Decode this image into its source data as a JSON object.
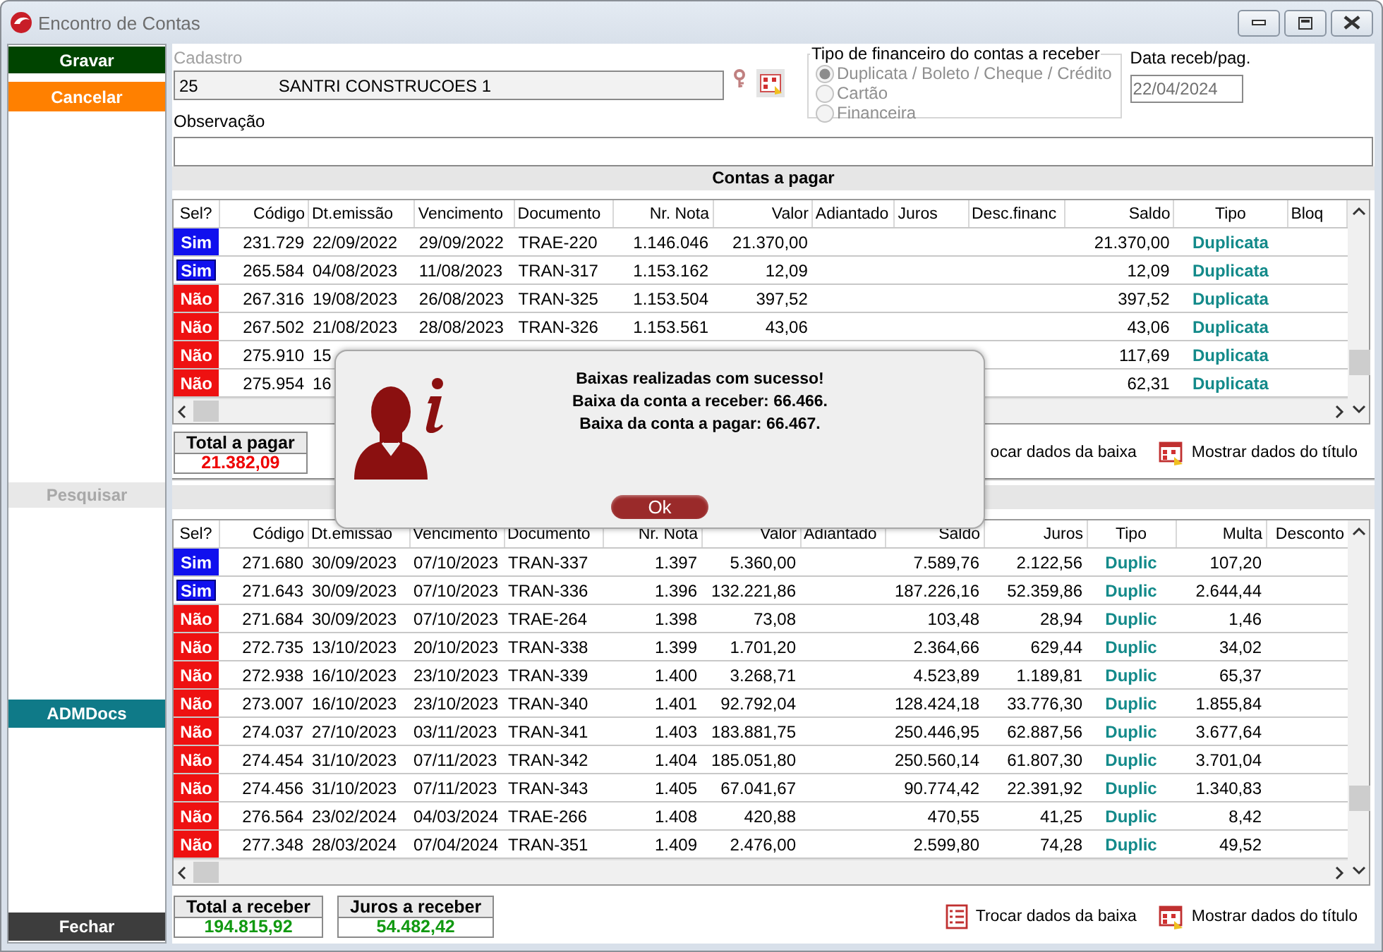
{
  "window": {
    "title": "Encontro de Contas"
  },
  "sidebar": {
    "buttons": [
      {
        "label": "Gravar",
        "kind": "confirm",
        "disabled": false
      },
      {
        "label": "Cancelar",
        "kind": "cancel",
        "disabled": false
      },
      {
        "label": "Pesquisar",
        "kind": "search",
        "disabled": true
      },
      {
        "label": "ADMDocs",
        "kind": "docs",
        "disabled": false
      },
      {
        "label": "Fechar",
        "kind": "close",
        "disabled": false
      }
    ]
  },
  "cadastro": {
    "label": "Cadastro",
    "code": "25",
    "name": "SANTRI CONSTRUCOES 1",
    "disabled": true
  },
  "tipo_financeiro": {
    "title": "Tipo de financeiro do contas a receber",
    "disabled": true,
    "options": [
      {
        "label": "Duplicata / Boleto / Cheque / Crédito",
        "selected": true
      },
      {
        "label": "Cartão",
        "selected": false
      },
      {
        "label": "Financeira",
        "selected": false
      }
    ]
  },
  "data_receb": {
    "label": "Data receb/pag.",
    "value": "22/04/2024",
    "disabled": true
  },
  "observacao": {
    "label": "Observação"
  },
  "contas_a_pagar": {
    "title": "Contas a pagar",
    "columns": [
      {
        "label": "Sel?",
        "kind": "sel"
      },
      {
        "label": "Código",
        "kind": "number"
      },
      {
        "label": "Dt.emissão",
        "kind": "text"
      },
      {
        "label": "Vencimento",
        "kind": "text"
      },
      {
        "label": "Documento",
        "kind": "text"
      },
      {
        "label": "Nr. Nota",
        "kind": "number"
      },
      {
        "label": "Valor",
        "kind": "number"
      },
      {
        "label": "Adiantado",
        "kind": "text"
      },
      {
        "label": "Juros",
        "kind": "text"
      },
      {
        "label": "Desc.financ",
        "kind": "text"
      },
      {
        "label": "Saldo",
        "kind": "number"
      },
      {
        "label": "Tipo",
        "kind": "tag"
      },
      {
        "label": "Bloq",
        "kind": "text"
      }
    ],
    "rows": [
      {
        "selected": true,
        "focused": false,
        "cells": [
          "Sim",
          "231.729",
          "22/09/2022",
          "29/09/2022",
          "TRAE-220",
          "1.146.046",
          "21.370,00",
          null,
          null,
          null,
          "21.370,00",
          "Duplicata",
          null
        ]
      },
      {
        "selected": true,
        "focused": true,
        "cells": [
          "Sim",
          "265.584",
          "04/08/2023",
          "11/08/2023",
          "TRAN-317",
          "1.153.162",
          "12,09",
          null,
          null,
          null,
          "12,09",
          "Duplicata",
          null
        ]
      },
      {
        "selected": false,
        "focused": false,
        "cells": [
          "Não",
          "267.316",
          "19/08/2023",
          "26/08/2023",
          "TRAN-325",
          "1.153.504",
          "397,52",
          null,
          null,
          null,
          "397,52",
          "Duplicata",
          null
        ]
      },
      {
        "selected": false,
        "focused": false,
        "cells": [
          "Não",
          "267.502",
          "21/08/2023",
          "28/08/2023",
          "TRAN-326",
          "1.153.561",
          "43,06",
          null,
          null,
          null,
          "43,06",
          "Duplicata",
          null
        ]
      },
      {
        "selected": false,
        "focused": false,
        "cells": [
          "Não",
          "275.910",
          "15",
          null,
          null,
          null,
          null,
          null,
          null,
          null,
          "117,69",
          "Duplicata",
          null
        ]
      },
      {
        "selected": false,
        "focused": false,
        "cells": [
          "Não",
          "275.954",
          "16",
          null,
          null,
          null,
          null,
          null,
          null,
          null,
          "62,31",
          "Duplicata",
          null
        ]
      }
    ]
  },
  "pagar_footer": {
    "totals": [
      {
        "label": "Total a pagar",
        "value": "21.382,09",
        "color": "#ee0000"
      }
    ],
    "actions": [
      {
        "label": "ocar dados da baixa",
        "kind": "plain"
      },
      {
        "label": "Mostrar dados do título",
        "kind": "show"
      }
    ]
  },
  "contas_a_receber": {
    "columns": [
      {
        "label": "Sel?",
        "kind": "sel"
      },
      {
        "label": "Código",
        "kind": "number"
      },
      {
        "label": "Dt.emissão",
        "kind": "text"
      },
      {
        "label": "Vencimento",
        "kind": "text"
      },
      {
        "label": "Documento",
        "kind": "text"
      },
      {
        "label": "Nr. Nota",
        "kind": "number"
      },
      {
        "label": "Valor",
        "kind": "number"
      },
      {
        "label": "Adiantado",
        "kind": "text"
      },
      {
        "label": "Saldo",
        "kind": "number"
      },
      {
        "label": "Juros",
        "kind": "number"
      },
      {
        "label": "Tipo",
        "kind": "tag"
      },
      {
        "label": "Multa",
        "kind": "number"
      },
      {
        "label": "Desconto",
        "kind": "number"
      }
    ],
    "rows": [
      {
        "selected": true,
        "focused": false,
        "cells": [
          "Sim",
          "271.680",
          "30/09/2023",
          "07/10/2023",
          "TRAN-337",
          "1.397",
          "5.360,00",
          null,
          "7.589,76",
          "2.122,56",
          "Duplic",
          "107,20",
          null
        ]
      },
      {
        "selected": true,
        "focused": true,
        "cells": [
          "Sim",
          "271.643",
          "30/09/2023",
          "07/10/2023",
          "TRAN-336",
          "1.396",
          "132.221,86",
          null,
          "187.226,16",
          "52.359,86",
          "Duplic",
          "2.644,44",
          null
        ]
      },
      {
        "selected": false,
        "focused": false,
        "cells": [
          "Não",
          "271.684",
          "30/09/2023",
          "07/10/2023",
          "TRAE-264",
          "1.398",
          "73,08",
          null,
          "103,48",
          "28,94",
          "Duplic",
          "1,46",
          null
        ]
      },
      {
        "selected": false,
        "focused": false,
        "cells": [
          "Não",
          "272.735",
          "13/10/2023",
          "20/10/2023",
          "TRAN-338",
          "1.399",
          "1.701,20",
          null,
          "2.364,66",
          "629,44",
          "Duplic",
          "34,02",
          null
        ]
      },
      {
        "selected": false,
        "focused": false,
        "cells": [
          "Não",
          "272.938",
          "16/10/2023",
          "23/10/2023",
          "TRAN-339",
          "1.400",
          "3.268,71",
          null,
          "4.523,89",
          "1.189,81",
          "Duplic",
          "65,37",
          null
        ]
      },
      {
        "selected": false,
        "focused": false,
        "cells": [
          "Não",
          "273.007",
          "16/10/2023",
          "23/10/2023",
          "TRAN-340",
          "1.401",
          "92.792,04",
          null,
          "128.424,18",
          "33.776,30",
          "Duplic",
          "1.855,84",
          null
        ]
      },
      {
        "selected": false,
        "focused": false,
        "cells": [
          "Não",
          "274.037",
          "27/10/2023",
          "03/11/2023",
          "TRAN-341",
          "1.403",
          "183.881,75",
          null,
          "250.446,95",
          "62.887,56",
          "Duplic",
          "3.677,64",
          null
        ]
      },
      {
        "selected": false,
        "focused": false,
        "cells": [
          "Não",
          "274.454",
          "31/10/2023",
          "07/11/2023",
          "TRAN-342",
          "1.404",
          "185.051,80",
          null,
          "250.560,14",
          "61.807,30",
          "Duplic",
          "3.701,04",
          null
        ]
      },
      {
        "selected": false,
        "focused": false,
        "cells": [
          "Não",
          "274.456",
          "31/10/2023",
          "07/11/2023",
          "TRAN-343",
          "1.405",
          "67.041,67",
          null,
          "90.774,42",
          "22.391,92",
          "Duplic",
          "1.340,83",
          null
        ]
      },
      {
        "selected": false,
        "focused": false,
        "cells": [
          "Não",
          "276.564",
          "23/02/2024",
          "04/03/2024",
          "TRAE-266",
          "1.408",
          "420,88",
          null,
          "470,55",
          "41,25",
          "Duplic",
          "8,42",
          null
        ]
      },
      {
        "selected": false,
        "focused": false,
        "cells": [
          "Não",
          "277.348",
          "28/03/2024",
          "07/04/2024",
          "TRAN-351",
          "1.409",
          "2.476,00",
          null,
          "2.599,80",
          "74,28",
          "Duplic",
          "49,52",
          null
        ]
      }
    ]
  },
  "receber_footer": {
    "totals": [
      {
        "label": "Total a receber",
        "value": "194.815,92",
        "color": "#119911"
      },
      {
        "label": "Juros a receber",
        "value": "54.482,42",
        "color": "#119911"
      }
    ],
    "actions": [
      {
        "label": "Trocar dados da baixa",
        "kind": "swap"
      },
      {
        "label": "Mostrar dados do título",
        "kind": "show"
      }
    ]
  },
  "dialog": {
    "lines": [
      "Baixas realizadas com sucesso!",
      "Baixa da conta a receber: 66.466.",
      "Baixa da conta a pagar: 66.467."
    ],
    "button": "Ok"
  }
}
